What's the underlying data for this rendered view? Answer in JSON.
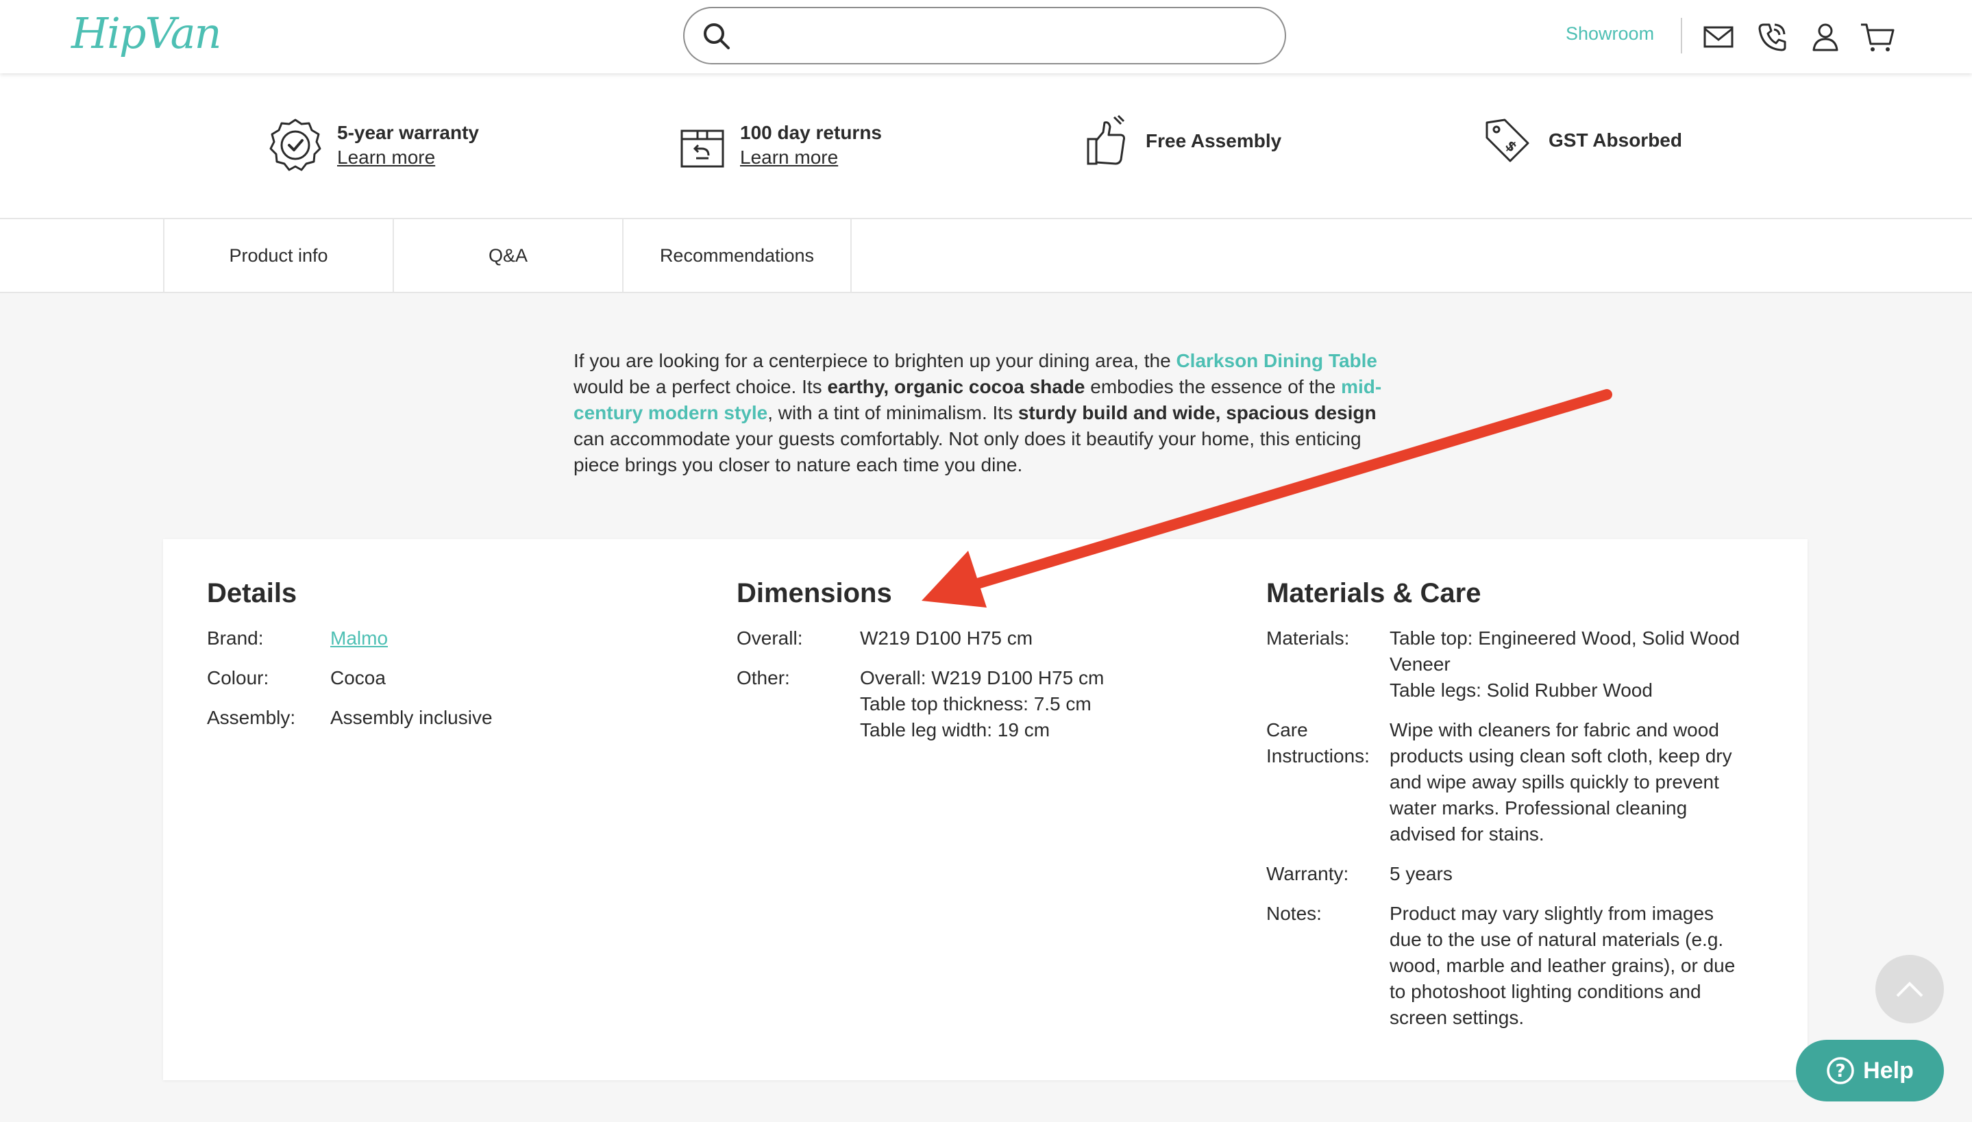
{
  "header": {
    "logo_text": "HipVan",
    "search_placeholder": "",
    "showroom_label": "Showroom",
    "icons": [
      "mail-icon",
      "phone-icon",
      "user-icon",
      "cart-icon"
    ],
    "accent_color": "#4dbfb3"
  },
  "perks": [
    {
      "title": "5-year warranty",
      "link": "Learn more",
      "icon": "warranty-badge-icon"
    },
    {
      "title": "100 day returns",
      "link": "Learn more",
      "icon": "returns-box-icon"
    },
    {
      "title": "Free Assembly",
      "link": "",
      "icon": "thumbs-up-tool-icon"
    },
    {
      "title": "GST Absorbed",
      "link": "",
      "icon": "price-tag-icon"
    }
  ],
  "tabs": [
    "Product info",
    "Q&A",
    "Recommendations"
  ],
  "description": {
    "p1": "If you are looking for a centerpiece to brighten up your dining area, the ",
    "link1": "Clarkson Dining Table",
    "p2": " would be a perfect choice. Its ",
    "bold1": "earthy, organic cocoa shade",
    "p3": " embodies the essence of the ",
    "link2": "mid-century modern style",
    "p4": ", with a tint of minimalism. Its ",
    "bold2": "sturdy build and wide, spacious design",
    "p5": " can accommodate your guests comfortably. Not only does it beautify your home, this enticing piece brings you closer to nature each time you dine."
  },
  "details": {
    "title": "Details",
    "brand_label": "Brand:",
    "brand_value": "Malmo",
    "colour_label": "Colour:",
    "colour_value": "Cocoa",
    "assembly_label": "Assembly:",
    "assembly_value": "Assembly inclusive"
  },
  "dimensions": {
    "title": "Dimensions",
    "overall_label": "Overall:",
    "overall_value": "W219 D100 H75 cm",
    "other_label": "Other:",
    "other_lines": [
      "Overall: W219 D100 H75 cm",
      "Table top thickness: 7.5 cm",
      "Table leg width: 19 cm"
    ]
  },
  "materials": {
    "title": "Materials & Care",
    "materials_label": "Materials:",
    "materials_lines": [
      "Table top: Engineered Wood, Solid Wood",
      "Veneer",
      "Table legs: Solid Rubber Wood"
    ],
    "care_label_1": "Care",
    "care_label_2": "Instructions:",
    "care_lines": [
      "Wipe with cleaners for fabric and wood",
      "products using clean soft cloth, keep dry",
      "and wipe away spills quickly to prevent",
      "water marks. Professional cleaning",
      "advised for stains."
    ],
    "warranty_label": "Warranty:",
    "warranty_value": "5 years",
    "notes_label": "Notes:",
    "notes_lines": [
      "Product may vary slightly from images",
      "due to the use of natural materials (e.g.",
      "wood, marble and leather grains), or due",
      "to photoshoot lighting conditions and",
      "screen settings."
    ]
  },
  "help_label": "Help",
  "annotation_arrow_color": "#e8402a"
}
